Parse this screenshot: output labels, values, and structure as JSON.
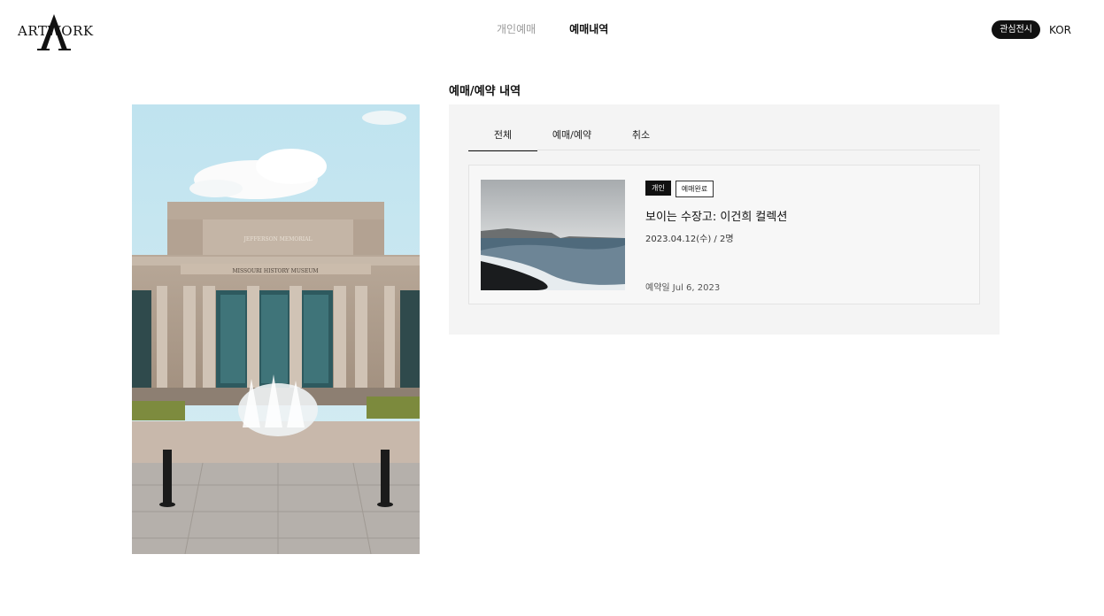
{
  "header": {
    "logo_text": "ARTWORK",
    "nav": [
      {
        "label": "개인예매",
        "active": false
      },
      {
        "label": "예매내역",
        "active": true
      }
    ],
    "favorites_label": "관심전시",
    "language_label": "KOR"
  },
  "page": {
    "section_title": "예매/예약 내역"
  },
  "tabs": [
    {
      "label": "전체",
      "active": true
    },
    {
      "label": "예매/예약",
      "active": false
    },
    {
      "label": "취소",
      "active": false
    }
  ],
  "booking": {
    "type_badge": "개인",
    "status_badge": "예매완료",
    "title": "보이는 수장고: 이건희 컬렉션",
    "date_people": "2023.04.12(수) / 2명",
    "reserved_on": "예약일 Jul 6, 2023"
  },
  "colors": {
    "accent": "#111111",
    "panel_bg": "#f4f4f4"
  }
}
